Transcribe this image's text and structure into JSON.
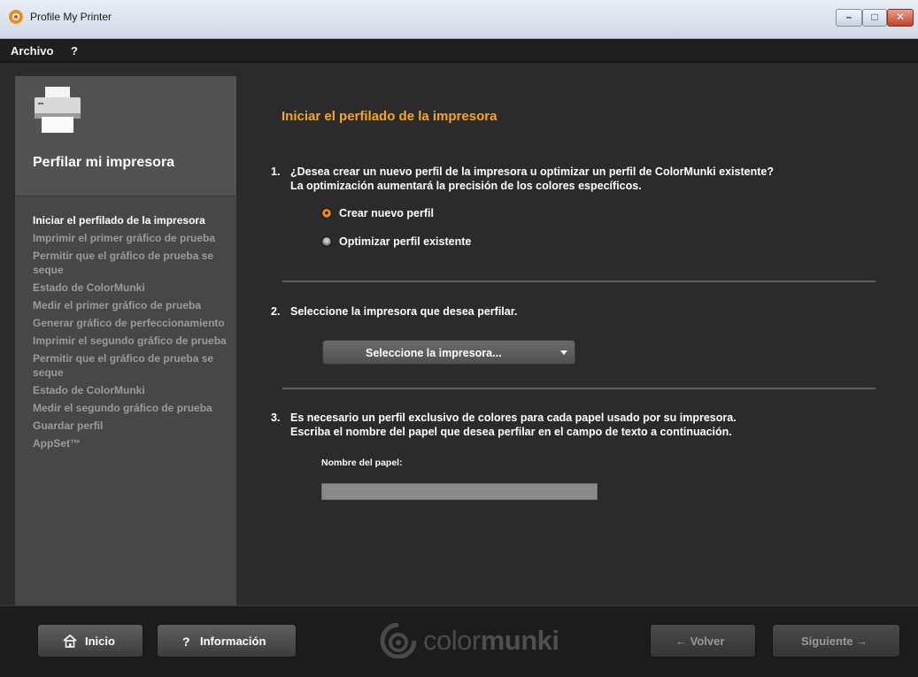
{
  "window": {
    "title": "Profile My Printer"
  },
  "menu": {
    "items": [
      "Archivo",
      "?"
    ]
  },
  "sidebar": {
    "title": "Perfilar mi impresora",
    "steps": [
      "Iniciar el perfilado de la impresora",
      "Imprimir el primer gráfico de prueba",
      "Permitir que el gráfico de prueba se seque",
      "Estado de ColorMunki",
      "Medir el primer gráfico de prueba",
      "Generar gráfico de perfeccionamiento",
      "Imprimir el segundo gráfico de prueba",
      "Permitir que el gráfico de prueba se seque",
      "Estado de ColorMunki",
      "Medir el segundo gráfico de prueba",
      "Guardar perfil",
      "AppSet™"
    ]
  },
  "main": {
    "section_title": "Iniciar el perfilado de la impresora",
    "q1": {
      "num": "1.",
      "line1": "¿Desea crear un nuevo perfil de la impresora u optimizar un perfil de ColorMunki existente?",
      "line2": "La optimización aumentará la precisión de los colores específicos.",
      "options": [
        "Crear nuevo perfil",
        "Optimizar perfil existente"
      ],
      "selected": "Crear nuevo perfil"
    },
    "q2": {
      "num": "2.",
      "text": "Seleccione la impresora que desea perfilar.",
      "select_label": "Seleccione la impresora..."
    },
    "q3": {
      "num": "3.",
      "line1": "Es necesario un perfil exclusivo de colores para cada papel usado por su impresora.",
      "line2": "Escriba el nombre del papel que desea perfilar en el campo de texto a continuación.",
      "field_label": "Nombre del papel:",
      "field_value": ""
    }
  },
  "footer": {
    "home": "Inicio",
    "info": "Información",
    "info_glyph": "?",
    "back": "← Volver",
    "next": "Siguiente →",
    "logo_pre": "color",
    "logo_bold": "munki"
  },
  "colors": {
    "accent": "#f5a623",
    "radio_selected": "#ff9b1a"
  }
}
